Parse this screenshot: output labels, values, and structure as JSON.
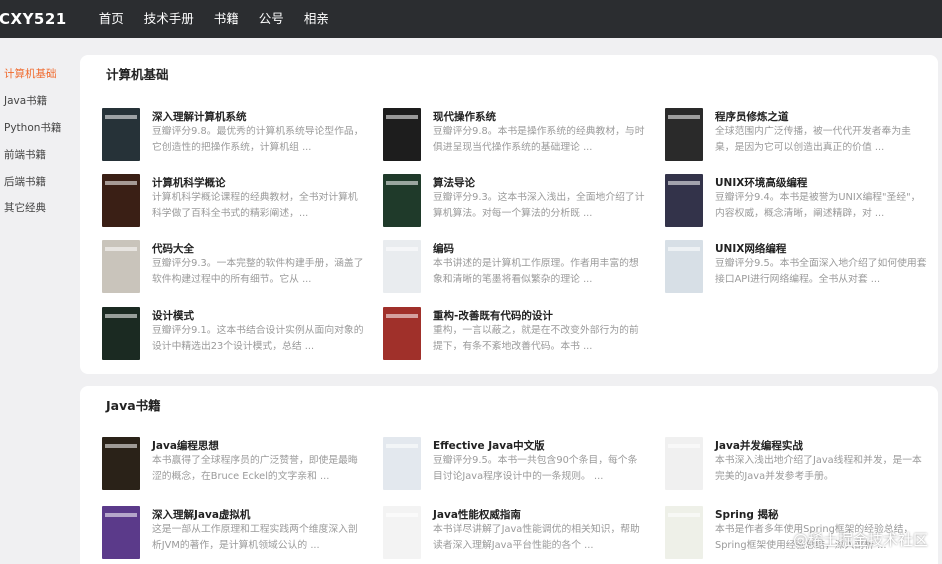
{
  "header": {
    "logo": "CXY521",
    "nav": [
      "首页",
      "技术手册",
      "书籍",
      "公号",
      "相亲"
    ]
  },
  "sidebar": {
    "items": [
      "计算机基础",
      "Java书籍",
      "Python书籍",
      "前端书籍",
      "后端书籍",
      "其它经典"
    ],
    "active_index": 0,
    "accent": "#f06a2d"
  },
  "sections": [
    {
      "title": "计算机基础",
      "books": [
        {
          "title": "深入理解计算机系统",
          "desc": "豆瓣评分9.8。最优秀的计算机系统导论型作品，它创造性的把操作系统，计算机组 ...",
          "cover": "#263238"
        },
        {
          "title": "现代操作系统",
          "desc": "豆瓣评分9.8。本书是操作系统的经典教材，与时俱进呈现当代操作系统的基础理论 ...",
          "cover": "#1d1d1d"
        },
        {
          "title": "程序员修炼之道",
          "desc": "全球范围内广泛传播，被一代代开发者奉为圭臬，是因为它可以创造出真正的价值 ...",
          "cover": "#2a2a2a"
        },
        {
          "title": "计算机科学概论",
          "desc": "计算机科学概论课程的经典教材，全书对计算机科学做了百科全书式的精彩阐述，...",
          "cover": "#3a1f15"
        },
        {
          "title": "算法导论",
          "desc": "豆瓣评分9.3。这本书深入浅出，全面地介绍了计算机算法。对每一个算法的分析既 ...",
          "cover": "#1f3a2a"
        },
        {
          "title": "UNIX环境高级编程",
          "desc": "豆瓣评分9.4。本书是被誉为UNIX编程\"圣经\"，内容权威，概念清晰，阐述精辟，对 ...",
          "cover": "#33334a"
        },
        {
          "title": "代码大全",
          "desc": "豆瓣评分9.3。一本完整的软件构建手册，涵盖了软件构建过程中的所有细节。它从 ...",
          "cover": "#c9c4bb"
        },
        {
          "title": "编码",
          "desc": "本书讲述的是计算机工作原理。作者用丰富的想象和清晰的笔墨将看似繁杂的理论 ...",
          "cover": "#e9ecef"
        },
        {
          "title": "UNIX网络编程",
          "desc": "豆瓣评分9.5。本书全面深入地介绍了如何使用套接口API进行网络编程。全书从对套 ...",
          "cover": "#d7dfe6"
        },
        {
          "title": "设计模式",
          "desc": "豆瓣评分9.1。这本书结合设计实例从面向对象的设计中精选出23个设计模式，总结 ...",
          "cover": "#1b2a22"
        },
        {
          "title": "重构-改善既有代码的设计",
          "desc": "重构，一言以蔽之，就是在不改变外部行为的前提下，有条不紊地改善代码。本书 ...",
          "cover": "#a0302a"
        }
      ]
    },
    {
      "title": "Java书籍",
      "books": [
        {
          "title": "Java编程思想",
          "desc": "本书赢得了全球程序员的广泛赞誉，即使是最晦涩的概念，在Bruce Eckel的文字亲和 ...",
          "cover": "#2a2218"
        },
        {
          "title": "Effective Java中文版",
          "desc": "豆瓣评分9.5。本书一共包含90个条目，每个条目讨论Java程序设计中的一条规则。 ...",
          "cover": "#e3e8ee"
        },
        {
          "title": "Java并发编程实战",
          "desc": "本书深入浅出地介绍了Java线程和并发，是一本完美的Java并发参考手册。",
          "cover": "#f0f0f0"
        },
        {
          "title": "深入理解Java虚拟机",
          "desc": "这是一部从工作原理和工程实践两个维度深入剖析JVM的著作，是计算机领域公认的 ...",
          "cover": "#5b3a8a"
        },
        {
          "title": "Java性能权威指南",
          "desc": "本书详尽讲解了Java性能调优的相关知识，帮助读者深入理解Java平台性能的各个 ...",
          "cover": "#f3f3f3"
        },
        {
          "title": "Spring 揭秘",
          "desc": "本书是作者多年使用Spring框架的经验总结，Spring框架使用经验总结，深入剖析 ...",
          "cover": "#eef0e8"
        }
      ]
    }
  ],
  "watermark": "@稀土掘金技术社区"
}
